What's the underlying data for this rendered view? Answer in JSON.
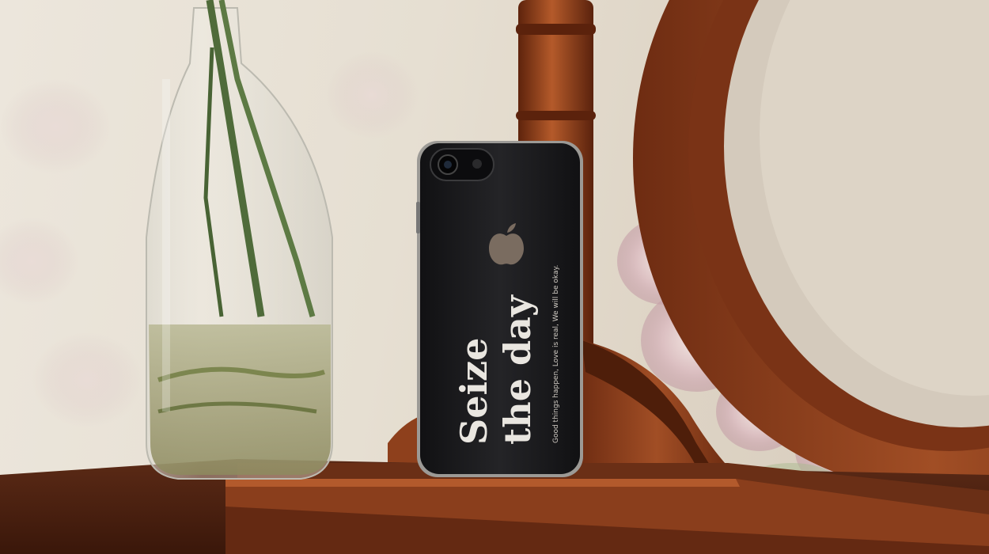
{
  "phone": {
    "headline_line1": "Seize",
    "headline_line2": "the day",
    "tagline": "Good things happen, Love is real, We will be okay."
  },
  "colors": {
    "wall": "#e8e1d5",
    "wood": "#8a3e1c",
    "wood_dark": "#5a2410",
    "phone_case": "#1c1c1e",
    "print": "#ebe7e0"
  },
  "icons": [
    "apple-logo-icon",
    "camera-icon"
  ]
}
